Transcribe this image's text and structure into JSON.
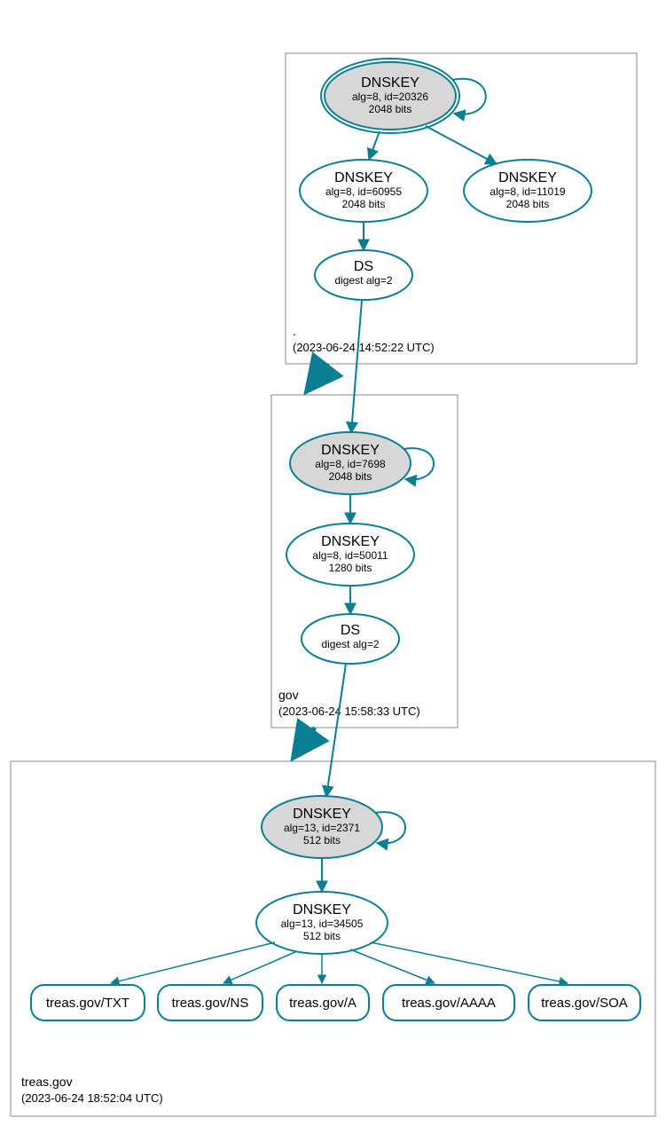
{
  "zones": {
    "root": {
      "label": ".",
      "timestamp": "(2023-06-24 14:52:22 UTC)"
    },
    "gov": {
      "label": "gov",
      "timestamp": "(2023-06-24 15:58:33 UTC)"
    },
    "treas": {
      "label": "treas.gov",
      "timestamp": "(2023-06-24 18:52:04 UTC)"
    }
  },
  "nodes": {
    "root_ksk": {
      "title": "DNSKEY",
      "line2": "alg=8, id=20326",
      "line3": "2048 bits"
    },
    "root_zsk1": {
      "title": "DNSKEY",
      "line2": "alg=8, id=60955",
      "line3": "2048 bits"
    },
    "root_zsk2": {
      "title": "DNSKEY",
      "line2": "alg=8, id=11019",
      "line3": "2048 bits"
    },
    "root_ds": {
      "title": "DS",
      "line2": "digest alg=2"
    },
    "gov_ksk": {
      "title": "DNSKEY",
      "line2": "alg=8, id=7698",
      "line3": "2048 bits"
    },
    "gov_zsk": {
      "title": "DNSKEY",
      "line2": "alg=8, id=50011",
      "line3": "1280 bits"
    },
    "gov_ds": {
      "title": "DS",
      "line2": "digest alg=2"
    },
    "treas_ksk": {
      "title": "DNSKEY",
      "line2": "alg=13, id=2371",
      "line3": "512 bits"
    },
    "treas_zsk": {
      "title": "DNSKEY",
      "line2": "alg=13, id=34505",
      "line3": "512 bits"
    }
  },
  "records": {
    "txt": "treas.gov/TXT",
    "ns": "treas.gov/NS",
    "a": "treas.gov/A",
    "aaaa": "treas.gov/AAAA",
    "soa": "treas.gov/SOA"
  },
  "colors": {
    "teal": "#0a7f94",
    "gray": "#d7d7d7"
  }
}
